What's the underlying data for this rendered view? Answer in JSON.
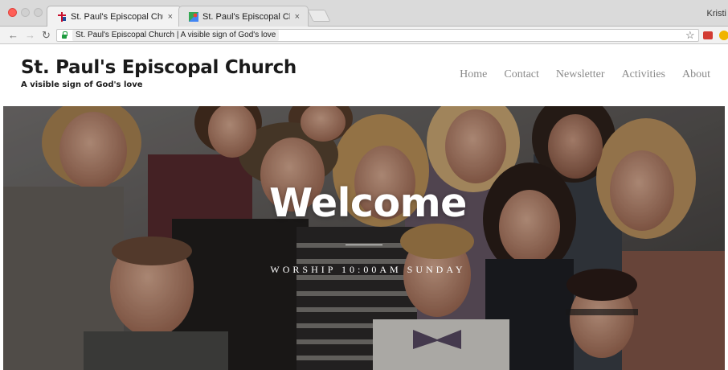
{
  "browser": {
    "tabs": [
      {
        "title": "St. Paul's Episcopal Church | A",
        "close": "×"
      },
      {
        "title": "St. Paul's Episcopal Church -",
        "close": "×"
      }
    ],
    "profile_name": "Kristi",
    "url": "St. Paul's Episcopal Church | A visible sign of God's love",
    "icons": [
      "back-arrow-icon",
      "forward-arrow-icon",
      "reload-icon",
      "lock-icon",
      "star-icon"
    ]
  },
  "site": {
    "title": "St. Paul's Episcopal Church",
    "tagline": "A visible sign of God's love",
    "nav": [
      "Home",
      "Contact",
      "Newsletter",
      "Activities",
      "About"
    ]
  },
  "hero": {
    "title": "Welcome",
    "subtitle": "WORSHIP 10:00AM SUNDAY"
  },
  "colors": {
    "site_title": "#1a1a1a",
    "nav_link": "#8a8a8a",
    "hero_text": "#ffffff",
    "tab_bar": "#dadada"
  }
}
